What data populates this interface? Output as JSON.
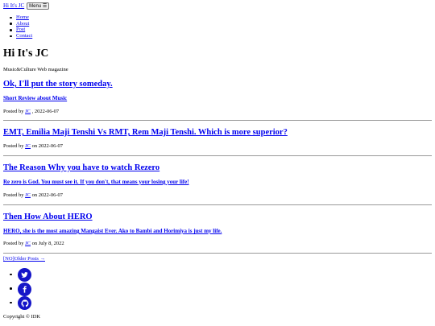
{
  "nav": {
    "brand": "Hi It's JC",
    "menu_label": "Menu ☰",
    "items": [
      {
        "label": "Home"
      },
      {
        "label": "About"
      },
      {
        "label": "Post"
      },
      {
        "label": "Contact"
      }
    ]
  },
  "header": {
    "title": "Hi It's JC",
    "tagline": "Music&Culture Web magazine"
  },
  "posts": [
    {
      "title": "Ok, I'll put the story someday.",
      "subtitle": "Short Review about Music",
      "posted_by": "Posted by ",
      "author": "JC",
      "date_text": " , 2022-06-07"
    },
    {
      "title": "EMT, Emilia Maji Tenshi Vs RMT, Rem Maji Tenshi. Which is more superior?",
      "posted_by": "Posted by ",
      "author": "JC",
      "date_text": " on 2022-06-07"
    },
    {
      "title": "The Reason Why you have to watch Rezero",
      "subtitle": "Re zero is God. You must see it. If you don't, that means your losing your life!",
      "posted_by": "Posted by ",
      "author": "JC",
      "date_text": " on 2022-06-07"
    },
    {
      "title": "Then How About HERO",
      "subtitle": "HERO, she is the most amazing Mangaist Ever. Ako to Bambi and Horimiya is just my life.",
      "posted_by": "Posted by ",
      "author": "JC",
      "date_text": " on July 8, 2022"
    }
  ],
  "pager": {
    "label": "[NO]Older Posts →"
  },
  "social": [
    {
      "icon": "twitter-icon"
    },
    {
      "icon": "facebook-icon"
    },
    {
      "icon": "github-icon"
    }
  ],
  "footer": {
    "copyright": "Copyright © IDK"
  },
  "colors": {
    "link": "#0000ee",
    "social_circle": "#1515c8",
    "rule": "#999999"
  }
}
